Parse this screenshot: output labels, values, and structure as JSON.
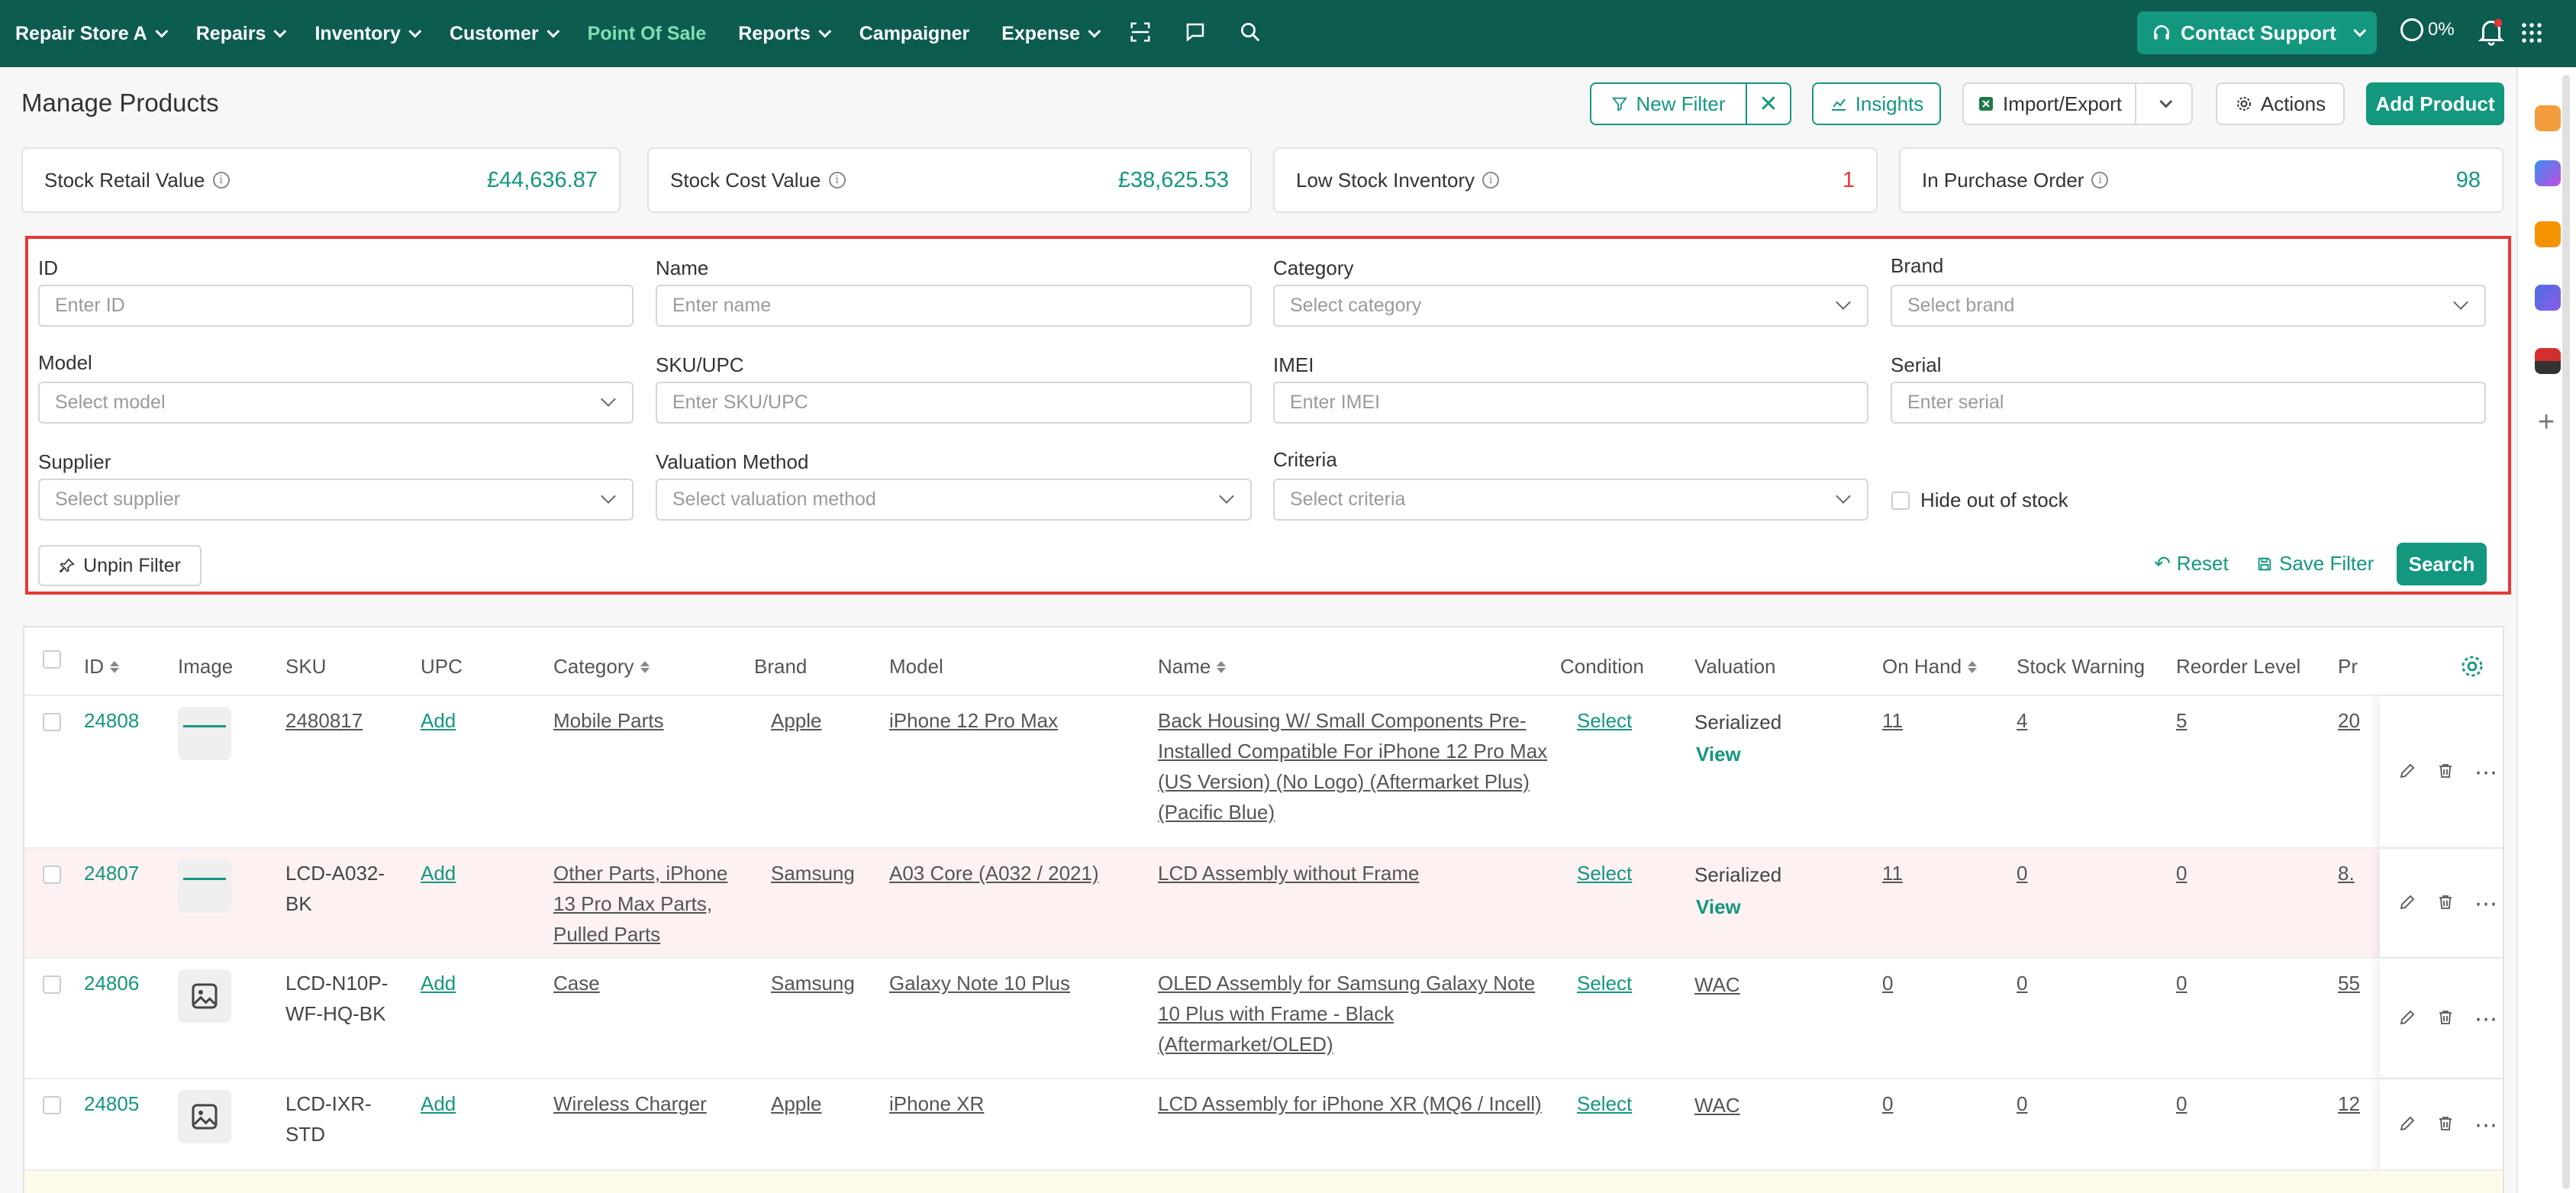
{
  "nav": {
    "items": [
      {
        "label": "Repair Store A",
        "dropdown": true
      },
      {
        "label": "Repairs",
        "dropdown": true
      },
      {
        "label": "Inventory",
        "dropdown": true
      },
      {
        "label": "Customer",
        "dropdown": true
      },
      {
        "label": "Point Of Sale",
        "dropdown": false,
        "active": true
      },
      {
        "label": "Reports",
        "dropdown": true
      },
      {
        "label": "Campaigner",
        "dropdown": false
      },
      {
        "label": "Expense",
        "dropdown": true
      }
    ],
    "contact_support": "Contact Support",
    "progress_pct": "0%"
  },
  "header": {
    "title": "Manage Products",
    "new_filter": "New Filter",
    "insights": "Insights",
    "import_export": "Import/Export",
    "actions": "Actions",
    "add_product": "Add Product"
  },
  "stats": [
    {
      "label": "Stock Retail Value",
      "value": "£44,636.87"
    },
    {
      "label": "Stock Cost Value",
      "value": "£38,625.53"
    },
    {
      "label": "Low Stock Inventory",
      "value": "1"
    },
    {
      "label": "In Purchase Order",
      "value": "98"
    }
  ],
  "filter": {
    "id": {
      "label": "ID",
      "placeholder": "Enter ID"
    },
    "name": {
      "label": "Name",
      "placeholder": "Enter name"
    },
    "category": {
      "label": "Category",
      "placeholder": "Select category"
    },
    "brand": {
      "label": "Brand",
      "placeholder": "Select brand"
    },
    "model": {
      "label": "Model",
      "placeholder": "Select model"
    },
    "sku": {
      "label": "SKU/UPC",
      "placeholder": "Enter SKU/UPC"
    },
    "imei": {
      "label": "IMEI",
      "placeholder": "Enter IMEI"
    },
    "serial": {
      "label": "Serial",
      "placeholder": "Enter serial"
    },
    "supplier": {
      "label": "Supplier",
      "placeholder": "Select supplier"
    },
    "valuation": {
      "label": "Valuation Method",
      "placeholder": "Select valuation method"
    },
    "criteria": {
      "label": "Criteria",
      "placeholder": "Select criteria"
    },
    "hide_out_of_stock": "Hide out of stock",
    "unpin": "Unpin Filter",
    "reset": "Reset",
    "save": "Save Filter",
    "search": "Search"
  },
  "table": {
    "headers": [
      "ID",
      "Image",
      "SKU",
      "UPC",
      "Category",
      "Brand",
      "Model",
      "Name",
      "Condition",
      "Valuation",
      "On Hand",
      "Stock Warning",
      "Reorder Level",
      "Pr"
    ],
    "rows": [
      {
        "id": "24808",
        "sku": "2480817",
        "upc": "Add",
        "category": "Mobile Parts",
        "brand": "Apple",
        "model": "iPhone 12 Pro Max",
        "name": "Back Housing W/ Small Components Pre-Installed Compatible For iPhone 12 Pro Max (US Version) (No Logo) (Aftermarket Plus) (Pacific Blue)",
        "condition": "Select",
        "valuation": "Serialized",
        "view": "View",
        "on_hand": "11",
        "stock_warning": "4",
        "reorder": "5",
        "price": "20"
      },
      {
        "id": "24807",
        "sku": "LCD-A032-BK",
        "upc": "Add",
        "category": "Other Parts, iPhone 13 Pro Max Parts, Pulled Parts",
        "brand": "Samsung",
        "model": "A03 Core (A032 / 2021)",
        "name": "LCD Assembly without Frame",
        "condition": "Select",
        "valuation": "Serialized",
        "view": "View",
        "on_hand": "11",
        "stock_warning": "0",
        "reorder": "0",
        "price": "8."
      },
      {
        "id": "24806",
        "sku": "LCD-N10P-WF-HQ-BK",
        "upc": "Add",
        "category": "Case",
        "brand": "Samsung",
        "model": "Galaxy Note 10 Plus",
        "name": "OLED Assembly for Samsung Galaxy Note 10 Plus with Frame - Black (Aftermarket/OLED)",
        "condition": "Select",
        "valuation": "WAC",
        "on_hand": "0",
        "stock_warning": "0",
        "reorder": "0",
        "price": "55"
      },
      {
        "id": "24805",
        "sku": "LCD-IXR-STD",
        "upc": "Add",
        "category": "Wireless Charger",
        "brand": "Apple",
        "model": "iPhone XR",
        "name": "LCD Assembly for iPhone XR (MQ6 / Incell)",
        "condition": "Select",
        "valuation": "WAC",
        "on_hand": "0",
        "stock_warning": "0",
        "reorder": "0",
        "price": "12"
      }
    ]
  },
  "colors": {
    "brand": "#0d5c50",
    "accent": "#14977f",
    "highlight": "#e53935",
    "row_highlight": "#fdf1f1"
  }
}
